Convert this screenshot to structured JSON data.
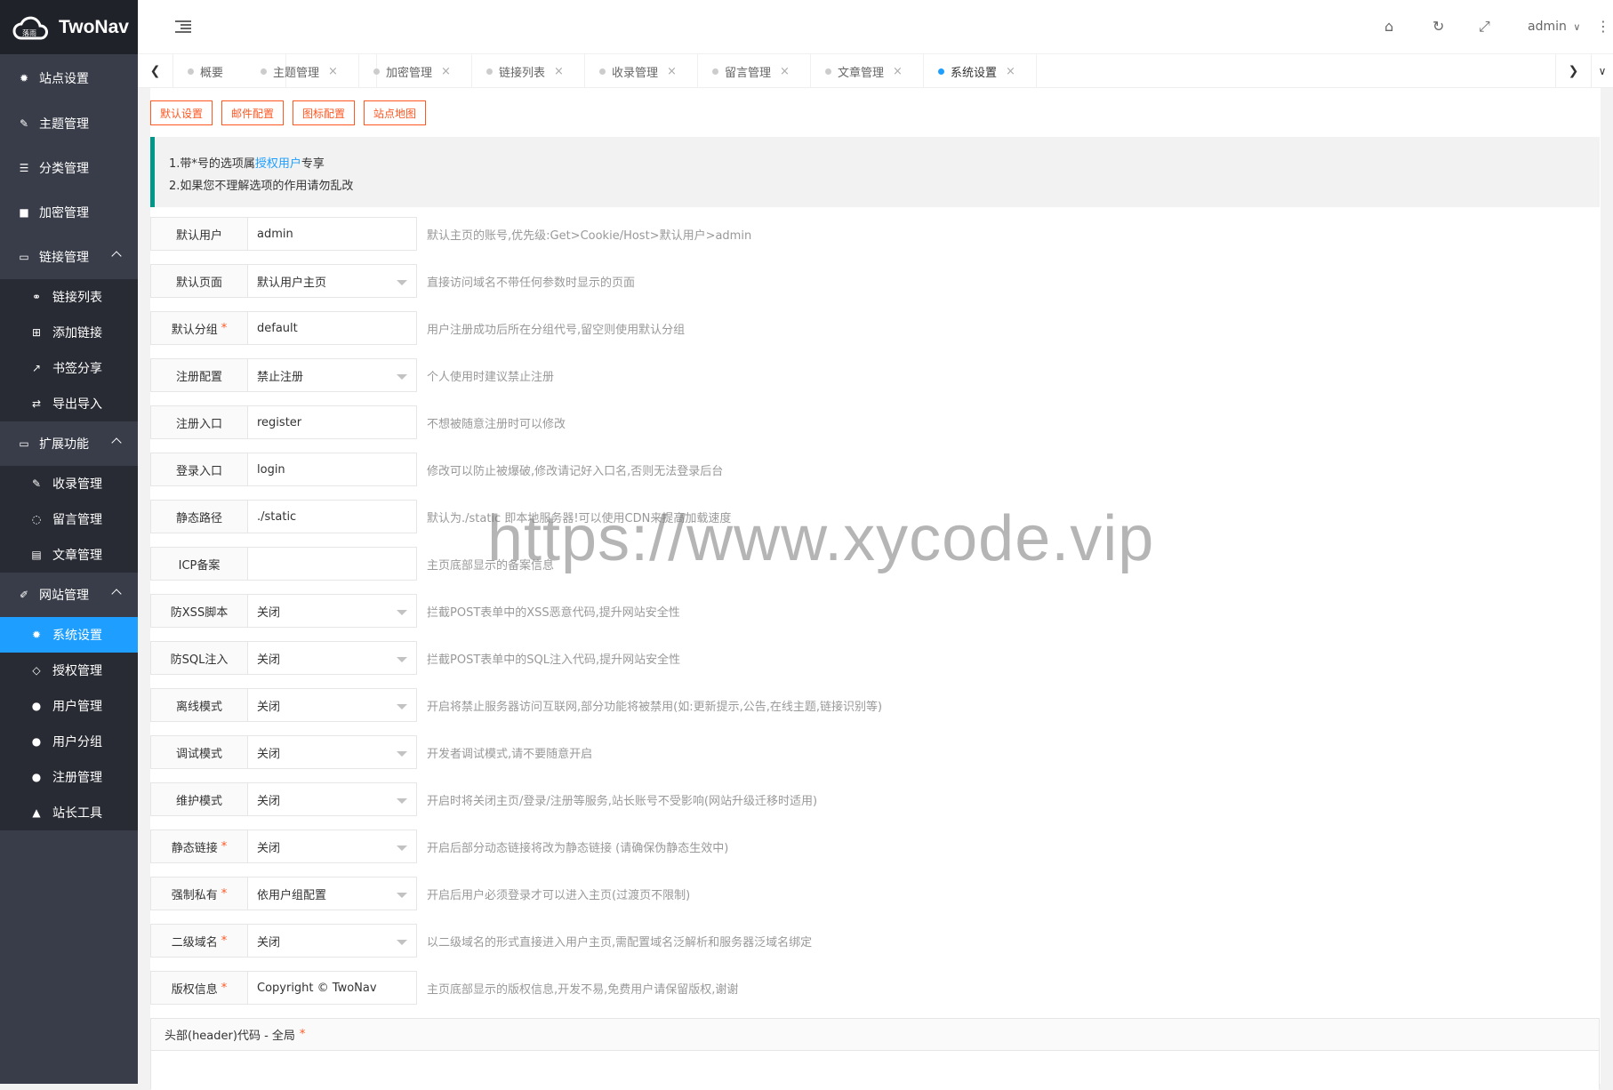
{
  "app": {
    "title": "TwoNav",
    "user": "admin"
  },
  "sidebar": {
    "items": [
      {
        "label": "站点设置",
        "icon": "gear-icon"
      },
      {
        "label": "主题管理",
        "icon": "brush-icon"
      },
      {
        "label": "分类管理",
        "icon": "list-icon"
      },
      {
        "label": "加密管理",
        "icon": "lock-icon"
      },
      {
        "label": "链接管理",
        "icon": "folder-icon"
      }
    ],
    "link_sub": [
      {
        "label": "链接列表",
        "icon": "link-icon"
      },
      {
        "label": "添加链接",
        "icon": "plus-square-icon"
      },
      {
        "label": "书签分享",
        "icon": "share-icon"
      },
      {
        "label": "导出导入",
        "icon": "exchange-icon"
      }
    ],
    "ext_label": "扩展功能",
    "ext_sub": [
      {
        "label": "收录管理",
        "icon": "pencil-icon"
      },
      {
        "label": "留言管理",
        "icon": "comment-icon"
      },
      {
        "label": "文章管理",
        "icon": "document-icon"
      }
    ],
    "site_label": "网站管理",
    "site_sub": [
      {
        "label": "系统设置",
        "icon": "cogs-icon"
      },
      {
        "label": "授权管理",
        "icon": "diamond-icon"
      },
      {
        "label": "用户管理",
        "icon": "user-icon"
      },
      {
        "label": "用户分组",
        "icon": "users-icon"
      },
      {
        "label": "注册管理",
        "icon": "user-plus-icon"
      },
      {
        "label": "站长工具",
        "icon": "warning-icon"
      }
    ]
  },
  "tabs": [
    "概要",
    "主题管理",
    "加密管理",
    "链接列表",
    "收录管理",
    "留言管理",
    "文章管理",
    "系统设置"
  ],
  "buttons": [
    "默认设置",
    "邮件配置",
    "图标配置",
    "站点地图"
  ],
  "notice": {
    "line1_pre": "1.带*号的选项属",
    "line1_link": "授权用户",
    "line1_post": "专享",
    "line2": "2.如果您不理解选项的作用请勿乱改"
  },
  "form": [
    {
      "label": "默认用户",
      "value": "admin",
      "hint": "默认主页的账号,优先级:Get>Cookie/Host>默认用户>admin"
    },
    {
      "label": "默认页面",
      "value": "默认用户主页",
      "hint": "直接访问域名不带任何参数时显示的页面"
    },
    {
      "label": "默认分组",
      "value": "default",
      "hint": "用户注册成功后所在分组代号,留空则使用默认分组"
    },
    {
      "label": "注册配置",
      "value": "禁止注册",
      "hint": "个人使用时建议禁止注册"
    },
    {
      "label": "注册入口",
      "value": "register",
      "hint": "不想被随意注册时可以修改"
    },
    {
      "label": "登录入口",
      "value": "login",
      "hint": "修改可以防止被爆破,修改请记好入口名,否则无法登录后台"
    },
    {
      "label": "静态路径",
      "value": "./static",
      "hint": "默认为./static 即本地服务器!可以使用CDN来提高加载速度"
    },
    {
      "label": "ICP备案",
      "value": "",
      "hint": "主页底部显示的备案信息"
    },
    {
      "label": "防XSS脚本",
      "value": "关闭",
      "hint": "拦截POST表单中的XSS恶意代码,提升网站安全性"
    },
    {
      "label": "防SQL注入",
      "value": "关闭",
      "hint": "拦截POST表单中的SQL注入代码,提升网站安全性"
    },
    {
      "label": "离线模式",
      "value": "关闭",
      "hint": "开启将禁止服务器访问互联网,部分功能将被禁用(如:更新提示,公告,在线主题,链接识别等)"
    },
    {
      "label": "调试模式",
      "value": "关闭",
      "hint": "开发者调试模式,请不要随意开启"
    },
    {
      "label": "维护模式",
      "value": "关闭",
      "hint": "开启时将关闭主页/登录/注册等服务,站长账号不受影响(网站升级迁移时适用)"
    },
    {
      "label": "静态链接",
      "value": "关闭",
      "hint": "开启后部分动态链接将改为静态链接 (请确保伪静态生效中)"
    },
    {
      "label": "强制私有",
      "value": "依用户组配置",
      "hint": "开启后用户必须登录才可以进入主页(过渡页不限制)"
    },
    {
      "label": "二级域名",
      "value": "关闭",
      "hint": "以二级域名的形式直接进入用户主页,需配置域名泛解析和服务器泛域名绑定"
    },
    {
      "label": "版权信息",
      "value": "Copyright © TwoNav",
      "hint": "主页底部显示的版权信息,开发不易,免费用户请保留版权,谢谢"
    }
  ],
  "code_header": "头部(header)代码 - 全局",
  "watermark": "https://www.xycode.vip",
  "colors": {
    "sidebar": "#393d49",
    "active": "#1e9fff",
    "accent": "#ff5722",
    "notice_bar": "#009688"
  }
}
